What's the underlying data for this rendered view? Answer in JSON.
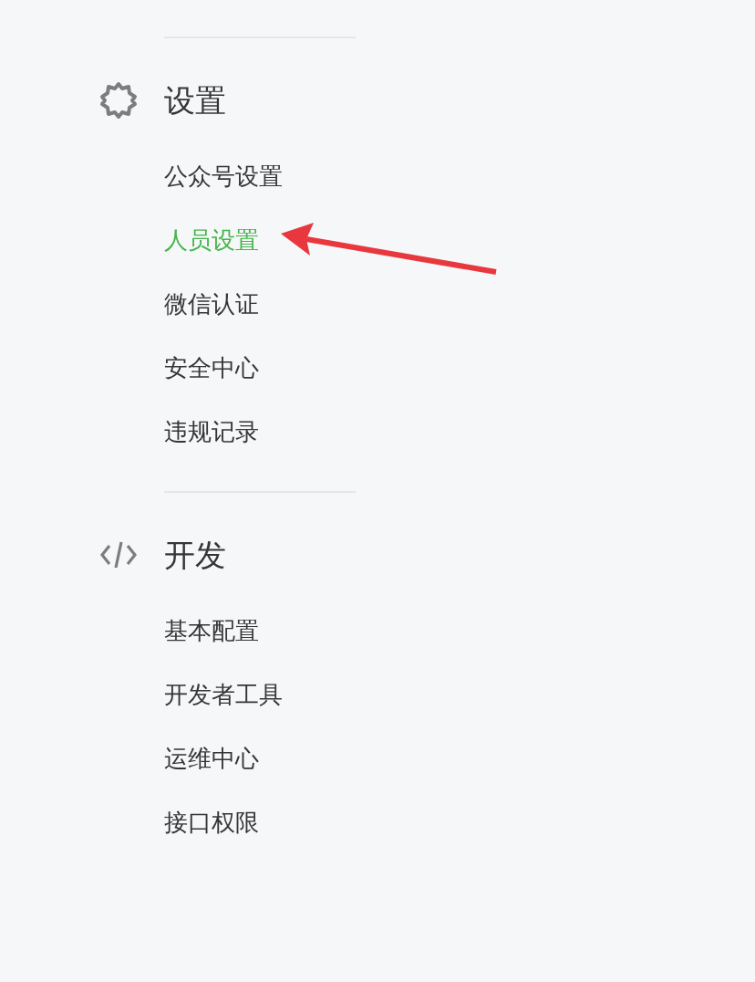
{
  "sections": [
    {
      "kind": "settings",
      "title": "设置",
      "items": [
        {
          "label": "公众号设置",
          "selected": false
        },
        {
          "label": "人员设置",
          "selected": true
        },
        {
          "label": "微信认证",
          "selected": false
        },
        {
          "label": "安全中心",
          "selected": false
        },
        {
          "label": "违规记录",
          "selected": false
        }
      ]
    },
    {
      "kind": "develop",
      "title": "开发",
      "items": [
        {
          "label": "基本配置",
          "selected": false
        },
        {
          "label": "开发者工具",
          "selected": false
        },
        {
          "label": "运维中心",
          "selected": false
        },
        {
          "label": "接口权限",
          "selected": false
        }
      ]
    }
  ]
}
